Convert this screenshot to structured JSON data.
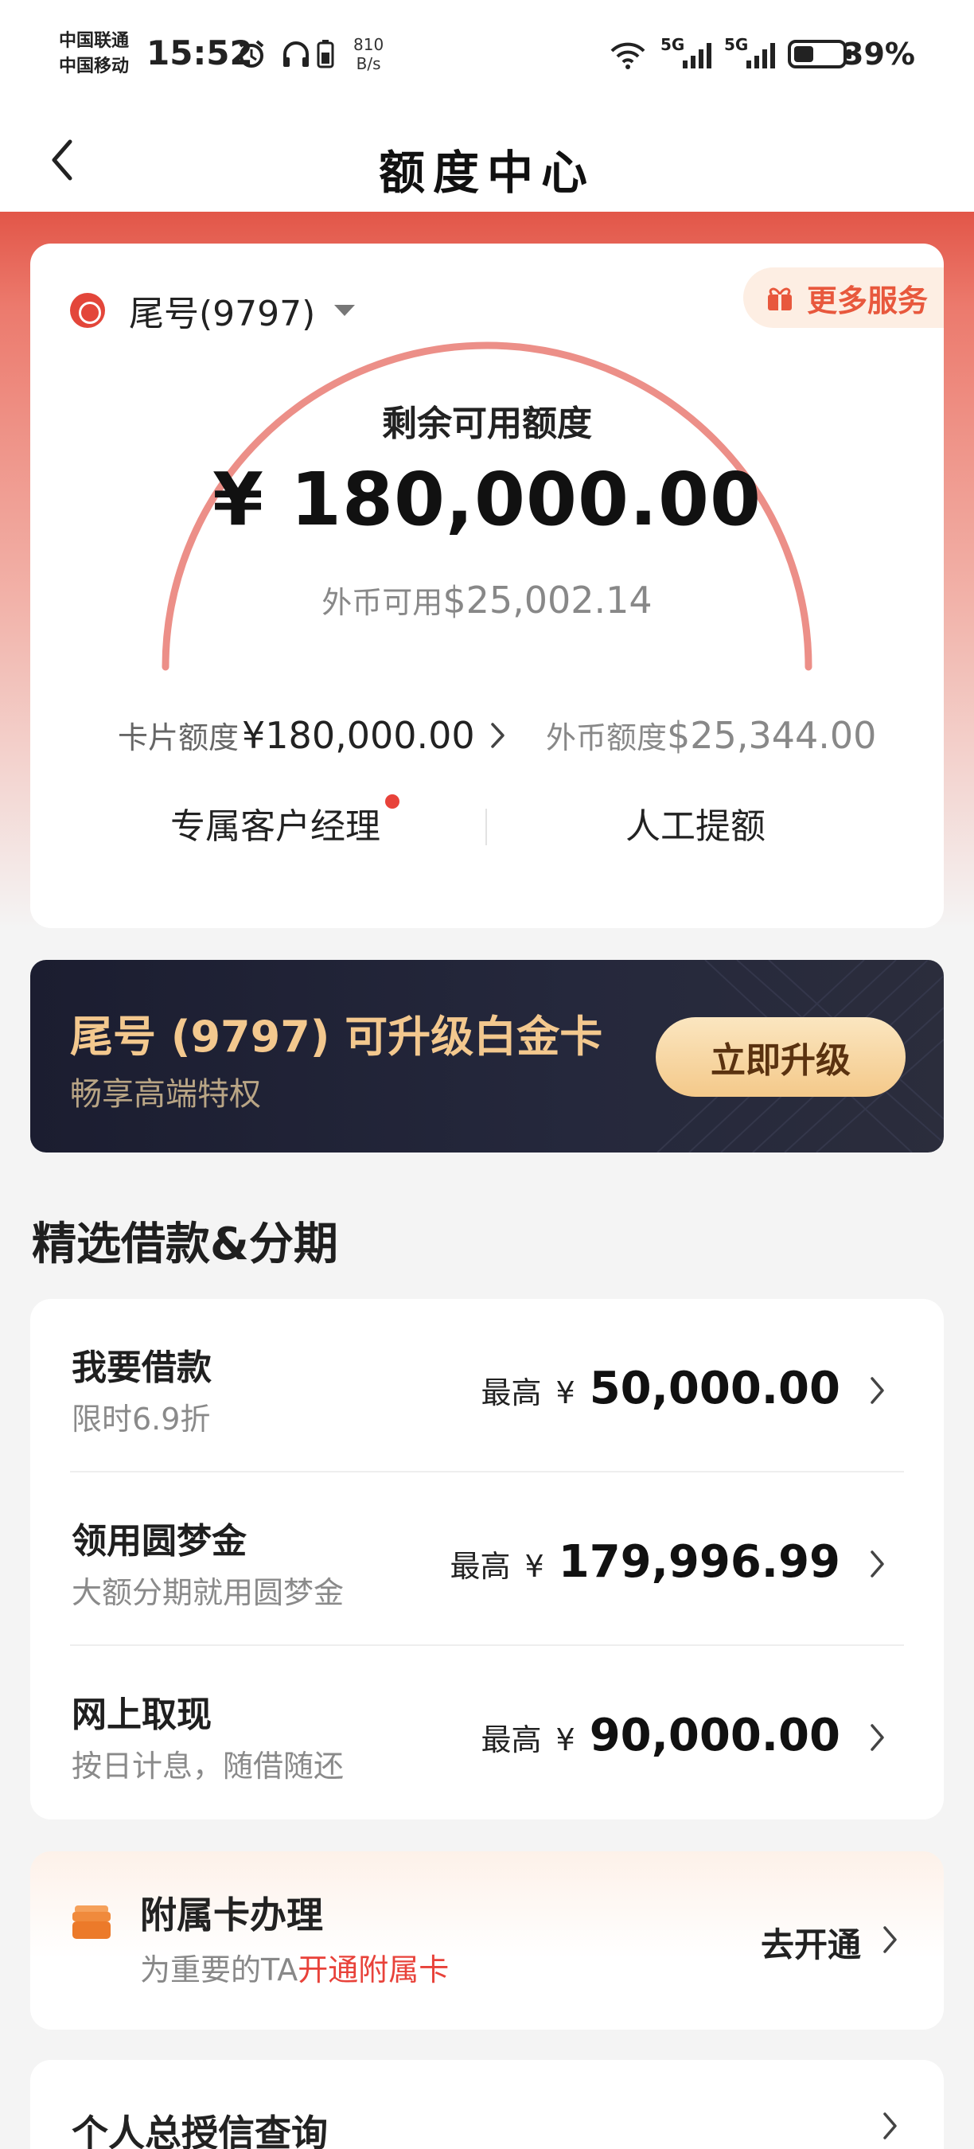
{
  "status_bar": {
    "carrier_1": "中国联通",
    "carrier_2": "中国移动",
    "time": "15:52",
    "net_speed_value": "810",
    "net_speed_unit": "B/s",
    "signal_1": "5G",
    "signal_2": "5G",
    "battery_percent": "39%"
  },
  "nav": {
    "title": "额度中心"
  },
  "quota": {
    "card_tail": "尾号(9797)",
    "more_services": "更多服务",
    "remaining_label": "剩余可用额度",
    "remaining_amount": "¥ 180,000.00",
    "fx_available_label": "外币可用",
    "fx_available_value": "$25,002.14",
    "card_limit_label": "卡片额度",
    "card_limit_value": "¥180,000.00",
    "fx_limit_label": "外币额度",
    "fx_limit_value": "$25,344.00",
    "manager": "专属客户经理",
    "manual_increase": "人工提额"
  },
  "upgrade": {
    "title": "尾号 (9797) 可升级白金卡",
    "subtitle": "畅享高端特权",
    "button": "立即升级"
  },
  "loans": {
    "section_title": "精选借款&分期",
    "items": [
      {
        "title": "我要借款",
        "desc": "限时6.9折",
        "max_label": "最高",
        "currency": "¥",
        "amount": "50,000.00"
      },
      {
        "title": "领用圆梦金",
        "desc": "大额分期就用圆梦金",
        "max_label": "最高",
        "currency": "¥",
        "amount": "179,996.99"
      },
      {
        "title": "网上取现",
        "desc": "按日计息，随借随还",
        "max_label": "最高",
        "currency": "¥",
        "amount": "90,000.00"
      }
    ]
  },
  "supplementary": {
    "title": "附属卡办理",
    "desc_prefix": "为重要的TA",
    "desc_highlight": "开通附属卡",
    "action": "去开通"
  },
  "credit_query": {
    "title": "个人总授信查询"
  },
  "colors": {
    "brand_red": "#e25648",
    "arc": "#ec8f88",
    "gold": "#f3c88e",
    "highlight": "#e8423a"
  }
}
